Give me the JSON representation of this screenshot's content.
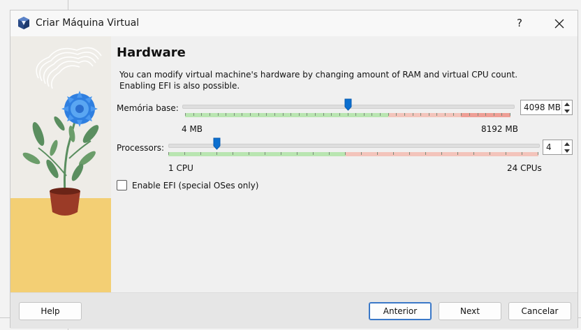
{
  "window": {
    "title": "Criar Máquina Virtual",
    "help_glyph": "?"
  },
  "page": {
    "heading": "Hardware",
    "description_line1": "You can modify virtual machine's hardware by changing amount of RAM and virtual CPU count.",
    "description_line2": "Enabling EFI is also possible."
  },
  "memory": {
    "label": "Memória base:",
    "value": "4098 MB",
    "min_label": "4 MB",
    "max_label": "8192 MB",
    "min": 4,
    "max": 8192,
    "current": 4098
  },
  "processors": {
    "label": "Processors:",
    "value": "4",
    "min_label": "1 CPU",
    "max_label": "24 CPUs",
    "min": 1,
    "max": 24,
    "current": 4
  },
  "efi": {
    "label": "Enable EFI (special OSes only)",
    "checked": false
  },
  "footer": {
    "help_label": "Help",
    "back_label": "Anterior",
    "next_label": "Next",
    "cancel_label": "Cancelar"
  },
  "colors": {
    "accent": "#0b6fcf",
    "range_green": "#b9e5b1",
    "range_red": "#f3c4bb",
    "range_darkred": "#ee9f96",
    "art_yellow": "#f3cf74",
    "art_blue_flower": "#2f7fe0",
    "art_leaf": "#5a8e5f",
    "art_pot": "#9b3b27"
  }
}
